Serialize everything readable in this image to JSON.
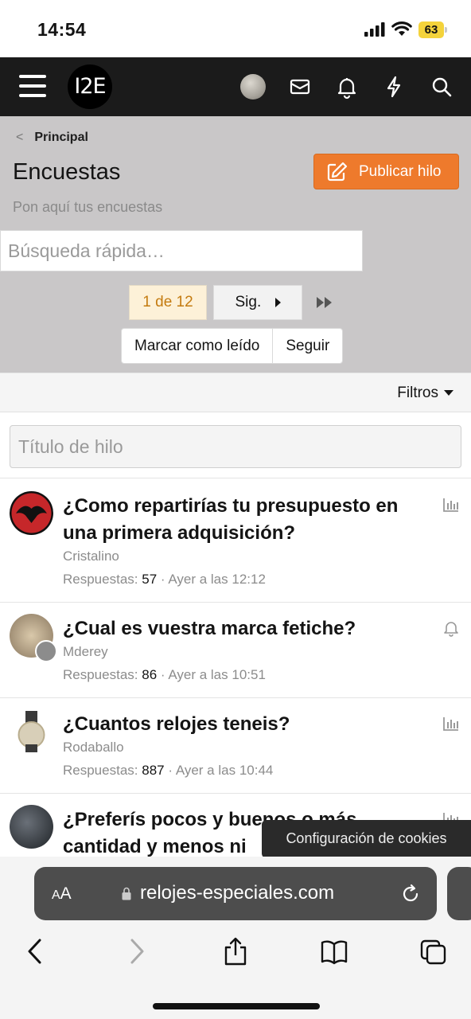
{
  "status": {
    "time": "14:54",
    "battery": "63"
  },
  "nav": {
    "logo": "I2E",
    "icons": [
      "menu-icon",
      "avatar",
      "mail-icon",
      "bell-icon",
      "lightning-icon",
      "search-icon"
    ]
  },
  "header": {
    "breadcrumb": "Principal",
    "title": "Encuestas",
    "publish_label": "Publicar hilo",
    "description": "Pon aquí tus encuestas",
    "quick_search_placeholder": "Búsqueda rápida…",
    "pager_current": "1 de 12",
    "pager_next": "Sig.",
    "mark_read": "Marcar como leído",
    "follow": "Seguir"
  },
  "filters": {
    "label": "Filtros",
    "title_placeholder": "Título de hilo"
  },
  "threads": [
    {
      "title": "¿Como repartirías tu presupuesto en una primera adquisición?",
      "author": "Cristalino",
      "replies_label": "Respuestas:",
      "replies": "57",
      "sep": "·",
      "time": "Ayer a las 12:12",
      "icon": "poll-icon"
    },
    {
      "title": "¿Cual es vuestra marca fetiche?",
      "author": "Mderey",
      "replies_label": "Respuestas:",
      "replies": "86",
      "sep": "·",
      "time": "Ayer a las 10:51",
      "icon": "bell-icon"
    },
    {
      "title": "¿Cuantos relojes teneis?",
      "author": "Rodaballo",
      "replies_label": "Respuestas:",
      "replies": "887",
      "sep": "·",
      "time": "Ayer a las 10:44",
      "icon": "poll-icon"
    },
    {
      "title": "¿Preferís pocos y buenos o más cantidad y menos ni",
      "icon": "poll-icon"
    }
  ],
  "cookies_label": "Configuración de cookies",
  "safari": {
    "aa_small": "A",
    "aa_big": "A",
    "url": "relojes-especiales.com"
  },
  "colors": {
    "accent": "#ee7a2c",
    "header_bg": "#c9c7c8",
    "nav_bg": "#1b1b1b"
  }
}
